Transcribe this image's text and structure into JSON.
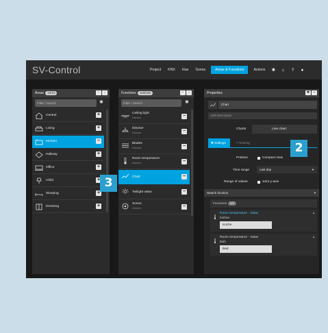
{
  "app": {
    "title": "SV-Control"
  },
  "menu": {
    "items": [
      "Project",
      "KNX",
      "Hue",
      "Sonos",
      "Areas & Functions",
      "Actions"
    ],
    "icons": [
      "gear-icon",
      "home-icon",
      "help-icon",
      "user-icon"
    ]
  },
  "areas": {
    "title": "Areas",
    "count": "10/10",
    "search_placeholder": "Filter / Search",
    "items": [
      {
        "label": "Central",
        "icon": "house-icon"
      },
      {
        "label": "Living",
        "icon": "sofa-icon"
      },
      {
        "label": "Kitchen",
        "icon": "kitchen-icon"
      },
      {
        "label": "Hallway",
        "icon": "hallway-icon"
      },
      {
        "label": "Office",
        "icon": "desk-icon"
      },
      {
        "label": "Child",
        "icon": "lamp-icon"
      },
      {
        "label": "Sleeping",
        "icon": "bed-icon"
      },
      {
        "label": "Dressing",
        "icon": "wardrobe-icon"
      }
    ]
  },
  "functions": {
    "title": "Functions",
    "count": "103/246",
    "search_placeholder": "Filter / Search",
    "items": [
      {
        "title": "Ceiling light",
        "sub": "Kitchen"
      },
      {
        "title": "Dimmer",
        "sub": "Kitchen"
      },
      {
        "title": "Blades",
        "sub": "Kitchen"
      },
      {
        "title": "Room temperature",
        "sub": "Kitchen"
      },
      {
        "title": "Chart",
        "sub": ""
      },
      {
        "title": "Twilight value",
        "sub": ""
      },
      {
        "title": "Sonos",
        "sub": "Kitchen"
      }
    ]
  },
  "properties": {
    "title": "Properties",
    "name_value": "Chart",
    "description_placeholder": "Edit description",
    "charts_label": "Charts",
    "chart_type": "Line chart",
    "tabs": [
      "Settings",
      "Sharing"
    ],
    "position_label": "Position",
    "compact_view": "Compact view",
    "time_range_label": "Time range",
    "time_range_value": "Last day",
    "range_values_label": "Range of values",
    "joint_axis": "Joint y-axis",
    "search_function": "Search function",
    "functions_label": "Functions",
    "functions_count": "2/2",
    "entries": [
      {
        "title": "Room temperature - Value",
        "area": "Kitchen",
        "value": "Küche"
      },
      {
        "title": "Room temperature - Value",
        "area": "Bath",
        "value": "Bad"
      }
    ]
  },
  "callouts": {
    "two": "2",
    "three": "3"
  },
  "colors": {
    "accent": "#00a3e0",
    "callout": "#2ba0d0",
    "background": "#cbdde8"
  }
}
